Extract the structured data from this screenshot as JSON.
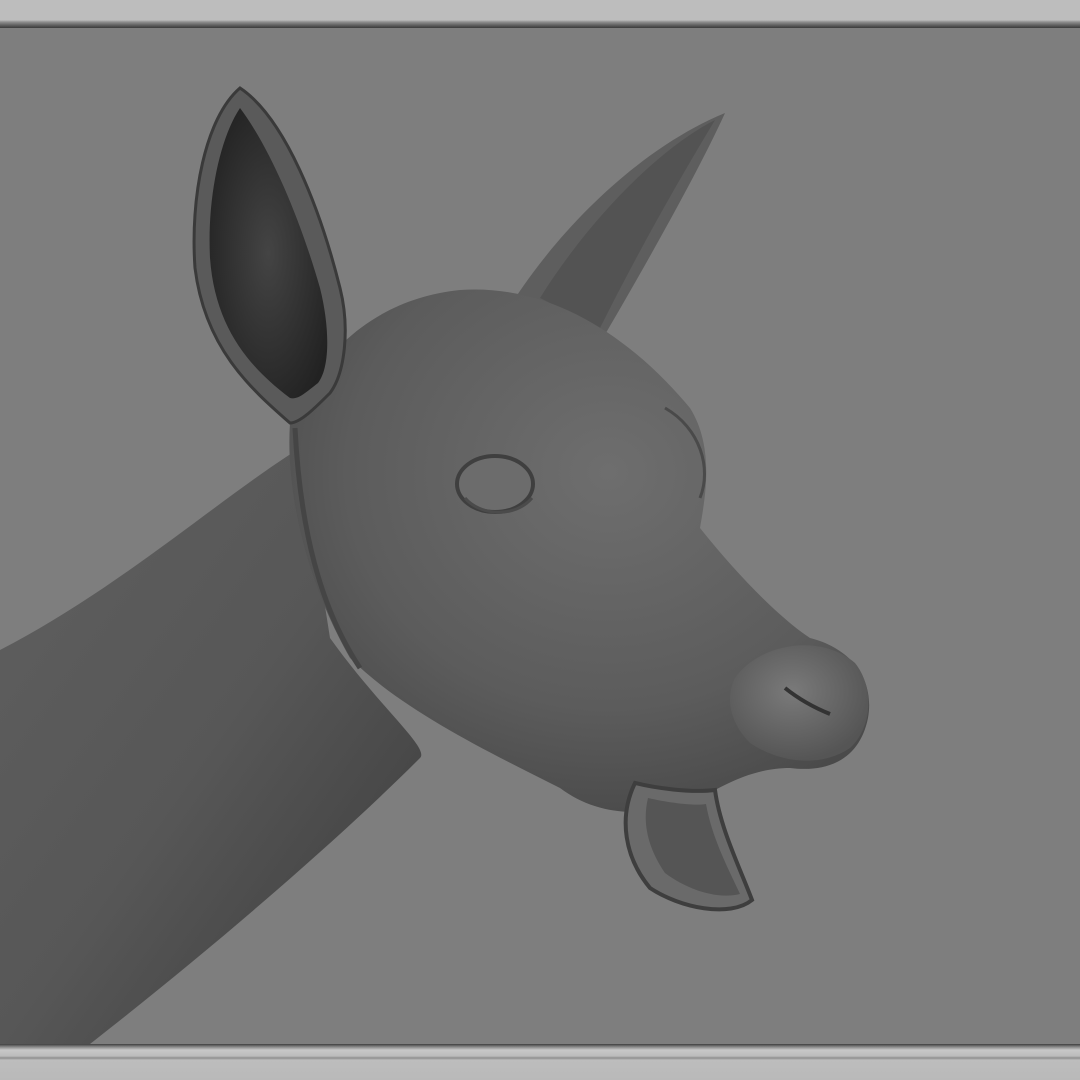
{
  "viewport": {
    "model_icon": "deer-head-mesh",
    "background_color": "#7e7e7e",
    "frame_color": "#bdbdbd",
    "mesh_color": "#606060"
  }
}
